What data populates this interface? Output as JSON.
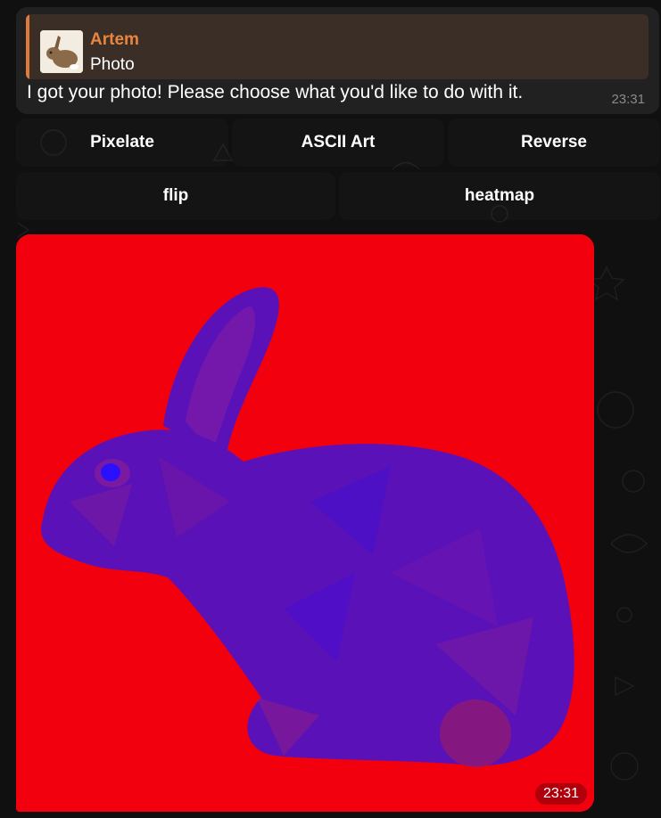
{
  "message": {
    "reply": {
      "sender": "Artem",
      "type": "Photo",
      "thumb_icon": "rabbit-thumbnail"
    },
    "text": "I got your photo! Please choose what you'd like to do with it.",
    "time": "23:31"
  },
  "keyboard": {
    "row1": [
      "Pixelate",
      "ASCII Art",
      "Reverse"
    ],
    "row2": [
      "flip",
      "heatmap"
    ]
  },
  "photo": {
    "time": "23:31",
    "subject_icon": "rabbit-heatmap-image"
  },
  "colors": {
    "sender": "#e8853f",
    "reply_bg": "#3b2e27",
    "photo_bg": "#f2000e",
    "rabbit": "#5a12b8"
  }
}
